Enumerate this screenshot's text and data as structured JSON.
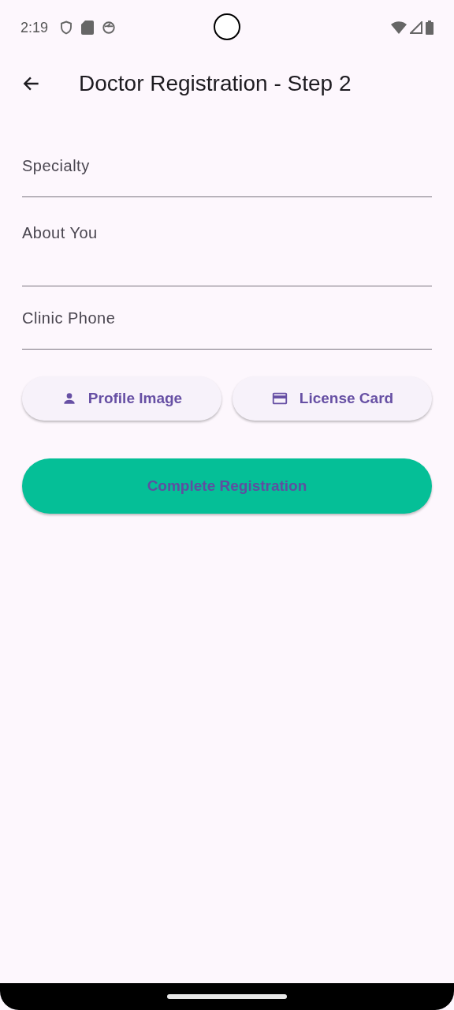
{
  "status_bar": {
    "time": "2:19"
  },
  "app_bar": {
    "title": "Doctor Registration - Step 2"
  },
  "fields": [
    {
      "placeholder": "Specialty",
      "kind": "single"
    },
    {
      "placeholder": "About You",
      "kind": "multi"
    },
    {
      "placeholder": "Clinic Phone",
      "kind": "single"
    }
  ],
  "upload_buttons": [
    {
      "label": "Profile Image",
      "kind": "person"
    },
    {
      "label": "License Card",
      "kind": "card"
    }
  ],
  "submit_button": {
    "label": "Complete Registration"
  }
}
